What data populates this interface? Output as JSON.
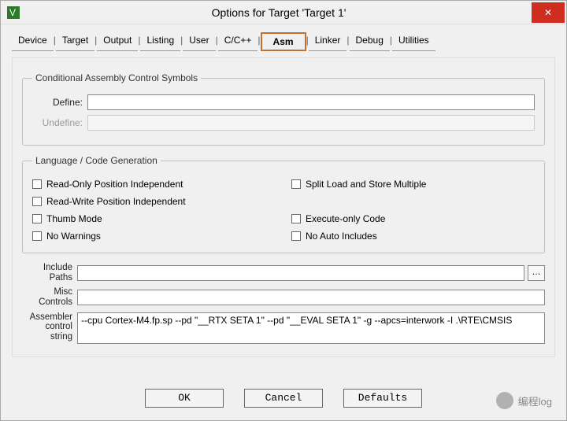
{
  "window": {
    "title": "Options for Target 'Target 1'"
  },
  "tabs": {
    "items": [
      "Device",
      "Target",
      "Output",
      "Listing",
      "User",
      "C/C++",
      "Asm",
      "Linker",
      "Debug",
      "Utilities"
    ],
    "active": "Asm"
  },
  "group_cond": {
    "legend": "Conditional Assembly Control Symbols",
    "define_label": "Define:",
    "define_value": "",
    "undefine_label": "Undefine:",
    "undefine_value": ""
  },
  "group_lang": {
    "legend": "Language / Code Generation",
    "opts": {
      "ro_pi": "Read-Only Position Independent",
      "rw_pi": "Read-Write Position Independent",
      "thumb": "Thumb Mode",
      "nowarn": "No Warnings",
      "split": "Split Load and Store Multiple",
      "execonly": "Execute-only Code",
      "noauto": "No Auto Includes"
    }
  },
  "fields": {
    "include_label": "Include Paths",
    "include_value": "",
    "misc_label": "Misc Controls",
    "misc_value": "",
    "asm_label": "Assembler control string",
    "asm_value": "--cpu Cortex-M4.fp.sp --pd \"__RTX SETA 1\" --pd \"__EVAL SETA 1\" -g --apcs=interwork -I .\\RTE\\CMSIS"
  },
  "buttons": {
    "ok": "OK",
    "cancel": "Cancel",
    "defaults": "Defaults"
  },
  "watermark": "编程log"
}
